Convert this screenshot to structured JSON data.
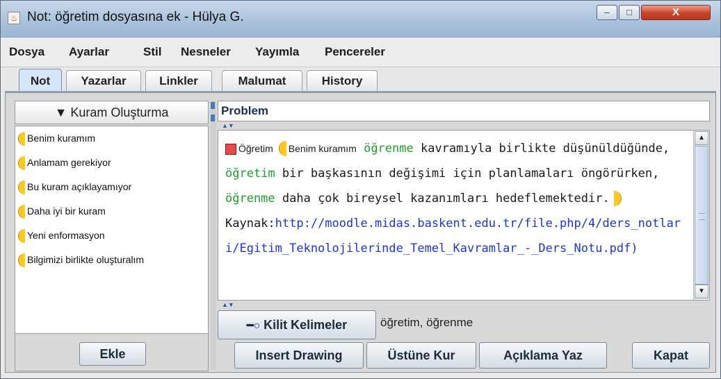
{
  "window": {
    "title": "Not: öğretim dosyasına ek - Hülya G.",
    "minimize_glyph": "–",
    "maximize_glyph": "□",
    "close_glyph": "X"
  },
  "menu": [
    "Dosya",
    "Ayarlar",
    "Stil",
    "Nesneler",
    "Yayımla",
    "Pencereler"
  ],
  "tabs": [
    {
      "label": "Not",
      "active": true
    },
    {
      "label": "Yazarlar",
      "active": false
    },
    {
      "label": "Linkler",
      "active": false
    },
    {
      "label": "Malumat",
      "active": false
    },
    {
      "label": "History",
      "active": false
    }
  ],
  "left_panel": {
    "header": "▼ Kuram Oluşturma",
    "items": [
      "Benim kuramım",
      "Anlamam gerekiyor",
      "Bu kuram açıklayamıyor",
      "Daha iyi bir kuram",
      "Yeni enformasyon",
      "Bilgimizi birlikte oluşturalım"
    ],
    "add_button": "Ekle"
  },
  "problem": {
    "label": "Problem",
    "value": ""
  },
  "note": {
    "support_label": "Öğretim",
    "scaffold_label": "Benim kuramım",
    "t1_kw": "öğrenme",
    "t2": " kavramıyla birlikte düşünüldüğünde, ",
    "t3_kw": "öğretim",
    "t4": " bir başkasının değişimi için planlamaları öngörürken, ",
    "t5_kw": "öğrenme",
    "t6": " daha çok bireysel kazanımları hedeflemektedir.",
    "source_label": "Kaynak:",
    "source_url": "http://moodle.midas.baskent.edu.tr/file.php/4/ders_notlari/Egitim_Teknolojilerinde_Temel_Kavramlar_-_Ders_Notu.pdf)"
  },
  "colors": {
    "keyword": "#1e9c2b",
    "url": "#1f36c8",
    "scaffold_bracket": "#ffc823"
  },
  "keywords": {
    "button_label": "Kilit Kelimeler",
    "button_icon": "key-icon",
    "value": "öğretim, öğrenme"
  },
  "buttons": {
    "insert_drawing": "Insert Drawing",
    "ustune_kur": "Üstüne Kur",
    "aciklama_yaz": "Açıklama Yaz",
    "kapat": "Kapat"
  }
}
